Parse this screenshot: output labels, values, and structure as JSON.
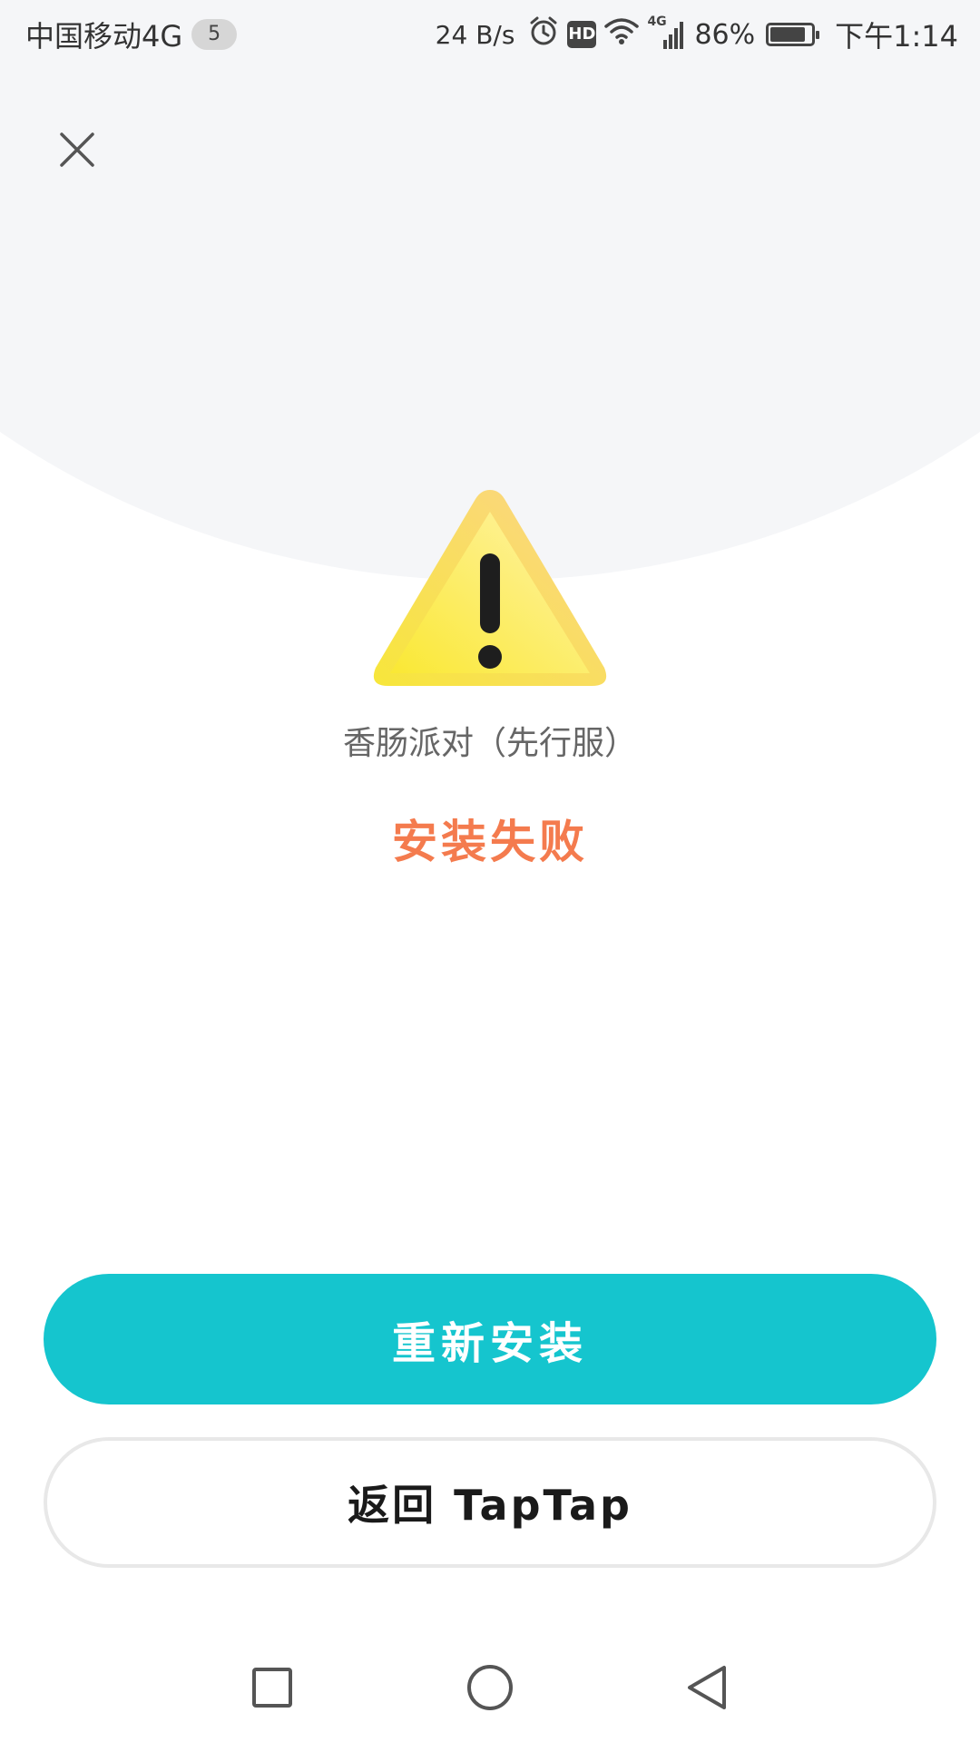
{
  "status_bar": {
    "carrier": "中国移动4G",
    "notification_count": "5",
    "net_speed": "24 B/s",
    "hd_label": "HD",
    "network_label": "4G",
    "battery_percent": "86%",
    "battery_level": 0.86,
    "time": "下午1:14",
    "icons": [
      "alarm-icon",
      "hd-icon",
      "wifi-icon",
      "signal-icon",
      "battery-icon"
    ]
  },
  "dialog": {
    "close_icon": "close-icon",
    "warning_icon": "warning-icon",
    "app_name": "香肠派对（先行服）",
    "status_text": "安装失败",
    "reinstall_label": "重新安装",
    "back_label": "返回 TapTap"
  },
  "nav_bar": {
    "icons": [
      "recent-apps-icon",
      "home-icon",
      "back-icon"
    ]
  },
  "colors": {
    "accent": "#15c5ce",
    "error": "#f47b4e",
    "header_bg": "#f5f6f8",
    "warning_yellow": "#f8e04a"
  }
}
